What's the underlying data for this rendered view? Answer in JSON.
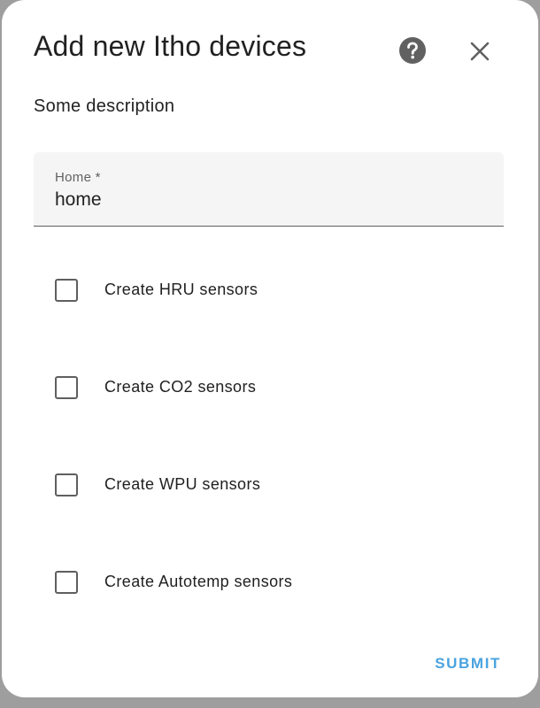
{
  "dialog": {
    "title": "Add new Itho devices",
    "description": "Some description",
    "help_icon": "help-circle-icon",
    "close_icon": "close-icon"
  },
  "home_field": {
    "label": "Home *",
    "value": "home"
  },
  "checkboxes": [
    {
      "label": "Create HRU sensors",
      "checked": false
    },
    {
      "label": "Create CO2 sensors",
      "checked": false
    },
    {
      "label": "Create WPU sensors",
      "checked": false
    },
    {
      "label": "Create Autotemp sensors",
      "checked": false
    }
  ],
  "actions": {
    "submit_label": "SUBMIT"
  },
  "colors": {
    "accent": "#4aa3df",
    "text": "#212121",
    "field_background": "#f5f5f5",
    "icon": "#616161"
  }
}
